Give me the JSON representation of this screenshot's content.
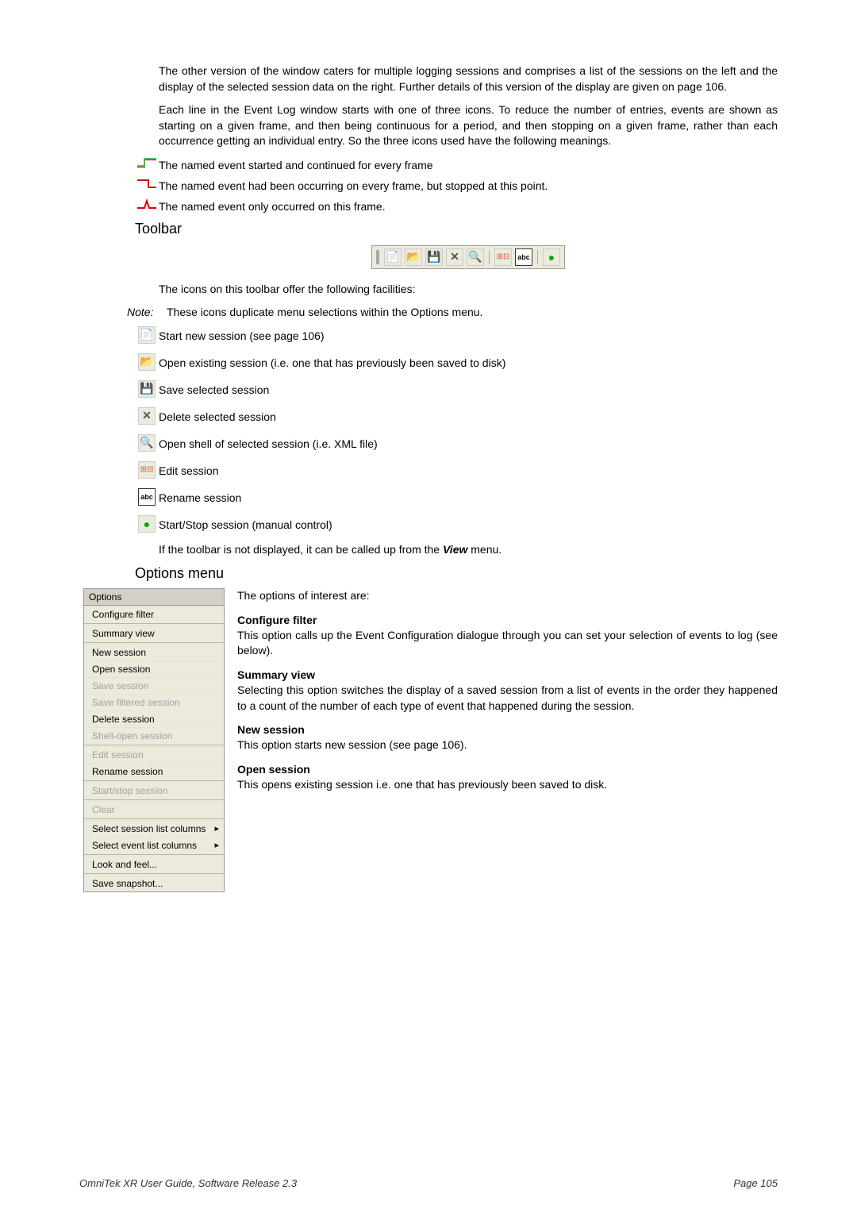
{
  "paragraphs": {
    "intro1": "The other version of the window caters for multiple logging sessions and comprises a list of the sessions on the left and the display of the selected session data on the right. Further details of this version of the display are given on page 106.",
    "intro2": "Each line in the Event Log window starts with one of three icons. To reduce the number of entries, events are shown as starting on a given frame, and then being continuous for a period, and then stopping on a given frame, rather than each occurrence getting an individual entry. So the three icons used have the following meanings.",
    "event_start": "The named event started and continued for every frame",
    "event_stop": "The named event had been occurring on every frame, but stopped at this point.",
    "event_once": "The named event only occurred on this frame."
  },
  "toolbar": {
    "heading": "Toolbar",
    "p1": "The icons on this toolbar offer the following facilities:",
    "note_label": "Note:",
    "note_text": "These icons duplicate menu selections within the Options menu.",
    "items": [
      "Start new session (see page 106)",
      "Open existing session (i.e. one that has previously been saved to disk)",
      "Save selected session",
      "Delete selected session",
      "Open shell of selected session (i.e. XML file)",
      "Edit session",
      "Rename session",
      "Start/Stop session (manual control)"
    ],
    "p2_prefix": "If the toolbar is not displayed, it can be called up from the ",
    "p2_bold": "View",
    "p2_suffix": " menu."
  },
  "options": {
    "heading": "Options menu",
    "intro": "The options of interest are:",
    "menu_header": "Options",
    "menu_groups": [
      [
        {
          "label": "Configure filter",
          "disabled": false
        }
      ],
      [
        {
          "label": "Summary view",
          "disabled": false
        }
      ],
      [
        {
          "label": "New session",
          "disabled": false
        },
        {
          "label": "Open session",
          "disabled": false
        },
        {
          "label": "Save session",
          "disabled": true
        },
        {
          "label": "Save filtered session",
          "disabled": true
        },
        {
          "label": "Delete session",
          "disabled": false
        },
        {
          "label": "Shell-open session",
          "disabled": true
        }
      ],
      [
        {
          "label": "Edit session",
          "disabled": true
        },
        {
          "label": "Rename session",
          "disabled": false
        }
      ],
      [
        {
          "label": "Start/stop session",
          "disabled": true
        }
      ],
      [
        {
          "label": "Clear",
          "disabled": true
        }
      ],
      [
        {
          "label": "Select session list columns",
          "disabled": false,
          "arrow": true
        },
        {
          "label": "Select event list columns",
          "disabled": false,
          "arrow": true
        }
      ],
      [
        {
          "label": "Look and feel...",
          "disabled": false
        }
      ],
      [
        {
          "label": "Save snapshot...",
          "disabled": false
        }
      ]
    ],
    "sections": [
      {
        "title": "Configure filter",
        "body": "This option calls up the Event Configuration dialogue through you can set your selection of events to log (see below)."
      },
      {
        "title": "Summary view",
        "body": "Selecting this option switches the display of a saved session from a list of events in the order they happened to a count of the number of each type of event that happened during the session."
      },
      {
        "title": "New session",
        "body": "This option starts new session (see page 106)."
      },
      {
        "title": "Open session",
        "body": "This opens existing session i.e. one that has previously been saved to disk."
      }
    ]
  },
  "footer": {
    "left": "OmniTek XR User Guide, Software Release 2.3",
    "right": "Page 105"
  }
}
